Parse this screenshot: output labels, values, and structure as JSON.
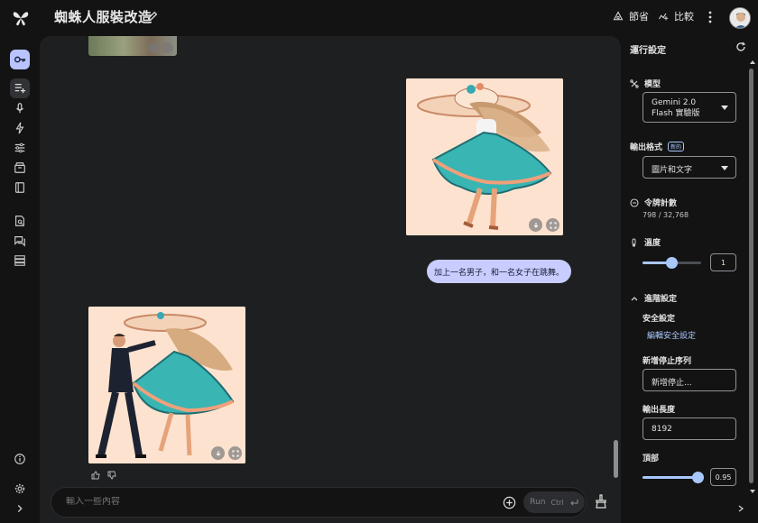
{
  "header": {
    "title": "蜘蛛人服裝改造",
    "save_label": "節省",
    "compare_label": "比較"
  },
  "chat": {
    "user_prompt": "加上一名男子，和一名女子在跳舞。",
    "composer_placeholder": "輸入一些內容",
    "run_label": "Run",
    "run_shortcut": "Ctrl"
  },
  "settings": {
    "title": "運行設定",
    "model_label": "模型",
    "model_value": "Gemini 2.0 Flash 實驗版",
    "output_format_label": "輸出格式",
    "new_badge": "新的",
    "output_format_value": "圖片和文字",
    "token_count_label": "令牌計數",
    "token_count_value": "798 / 32,768",
    "temperature_label": "溫度",
    "temperature_value": "1",
    "temperature_level": 0.5,
    "advanced_label": "進階設定",
    "safety_label": "安全設定",
    "safety_link": "編輯安全設定",
    "stop_seq_label": "新增停止序列",
    "stop_seq_placeholder": "新增停止...",
    "output_length_label": "輸出長度",
    "output_length_value": "8192",
    "top_p_label": "頂部",
    "top_p_value": "0.95",
    "top_p_level": 0.95
  },
  "colors": {
    "accent": "#a8c7fa",
    "bubble": "#c8ccff",
    "key_button": "#b9c4ff",
    "chat_bg": "#1e1f20",
    "page_bg": "#131314"
  }
}
